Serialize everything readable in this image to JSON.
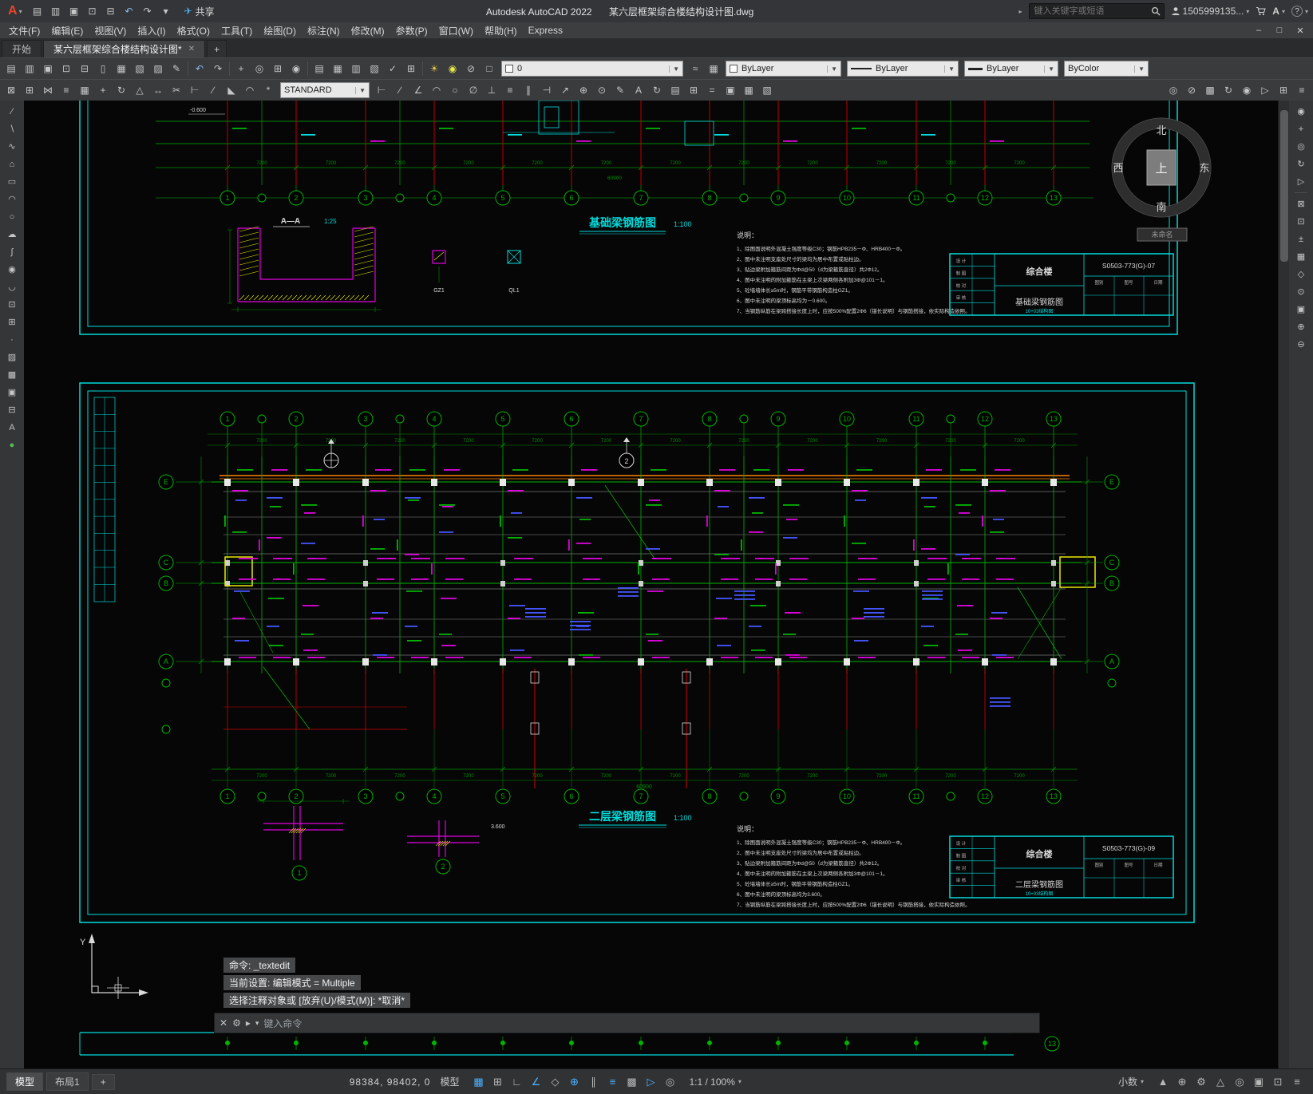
{
  "titlebar": {
    "logo": "A",
    "quick_access": [
      {
        "n": "qat-new-icon",
        "g": "▤"
      },
      {
        "n": "qat-open-icon",
        "g": "▥"
      },
      {
        "n": "qat-save-icon",
        "g": "▣"
      },
      {
        "n": "qat-save-as-icon",
        "g": "⊡"
      },
      {
        "n": "qat-plot-icon",
        "g": "⊟"
      },
      {
        "n": "qat-undo-icon",
        "g": "↶",
        "c": "#8ab8e8"
      },
      {
        "n": "qat-redo-icon",
        "g": "↷"
      },
      {
        "n": "qat-customize-icon",
        "g": "▾"
      }
    ],
    "share_label": "共享",
    "app_title": "Autodesk AutoCAD 2022",
    "doc_title": "某六层框架综合楼结构设计图.dwg",
    "search_placeholder": "键入关键字或短语",
    "user_id": "1505999135...",
    "help_label": "?"
  },
  "menubar": {
    "items": [
      "文件(F)",
      "编辑(E)",
      "视图(V)",
      "插入(I)",
      "格式(O)",
      "工具(T)",
      "绘图(D)",
      "标注(N)",
      "修改(M)",
      "参数(P)",
      "窗口(W)",
      "帮助(H)",
      "Express"
    ],
    "minimize": "–",
    "restore": "□",
    "close": "✕"
  },
  "tabs": {
    "start": "开始",
    "doc": "某六层框架综合楼结构设计图*",
    "close": "✕",
    "new_tab": "+"
  },
  "toolbar1": {
    "icons_a": [
      {
        "n": "new-icon",
        "g": "▤"
      },
      {
        "n": "open-icon",
        "g": "▥"
      },
      {
        "n": "save-icon",
        "g": "▣"
      },
      {
        "n": "save-as-icon",
        "g": "⊡"
      },
      {
        "n": "plot-icon",
        "g": "⊟"
      },
      {
        "n": "plot-preview-icon",
        "g": "▯"
      },
      {
        "n": "publish-icon",
        "g": "▦"
      },
      {
        "n": "copy-clip-icon",
        "g": "▧"
      },
      {
        "n": "paste-icon",
        "g": "▨"
      },
      {
        "n": "match-properties-icon",
        "g": "✎"
      },
      {
        "sep": true
      },
      {
        "n": "undo-icon",
        "g": "↶",
        "c": "#8ab8e8"
      },
      {
        "n": "redo-icon",
        "g": "↷"
      },
      {
        "sep": true
      },
      {
        "n": "pan-icon",
        "g": "+"
      },
      {
        "n": "zoom-realtime-icon",
        "g": "◎"
      },
      {
        "n": "zoom-window-icon",
        "g": "⊞"
      },
      {
        "n": "zoom-previous-icon",
        "g": "◉"
      },
      {
        "sep": true
      },
      {
        "n": "properties-icon",
        "g": "▤"
      },
      {
        "n": "designcenter-icon",
        "g": "▦"
      },
      {
        "n": "tool-palettes-icon",
        "g": "▥"
      },
      {
        "n": "sheet-set-manager-icon",
        "g": "▧"
      },
      {
        "n": "markup-icon",
        "g": "✓"
      },
      {
        "n": "quickcalc-icon",
        "g": "⊞"
      },
      {
        "sep": true
      },
      {
        "n": "sun-icon",
        "g": "☀",
        "c": "#e8c84a"
      },
      {
        "n": "lamp-icon",
        "g": "◉",
        "c": "#e8e84a"
      },
      {
        "n": "lock-icon",
        "g": "⊘"
      },
      {
        "n": "layer-color-icon",
        "g": "□"
      }
    ],
    "layer_value": "0",
    "icons_b": [
      {
        "n": "layer-previous-icon",
        "g": "≈"
      },
      {
        "n": "layer-states-icon",
        "g": "▦"
      }
    ],
    "color_value": "ByLayer",
    "linetype_value": "ByLayer",
    "lineweight_value": "ByLayer",
    "plotstyle_value": "ByColor"
  },
  "toolbar2": {
    "icons_a": [
      {
        "n": "erase-icon",
        "g": "⊠"
      },
      {
        "n": "copy-icon",
        "g": "⊞"
      },
      {
        "n": "mirror-icon",
        "g": "⋈"
      },
      {
        "n": "offset-icon",
        "g": "≡"
      },
      {
        "n": "array-icon",
        "g": "▦"
      },
      {
        "n": "move-icon",
        "g": "+"
      },
      {
        "n": "rotate-icon",
        "g": "↻"
      },
      {
        "n": "scale-icon",
        "g": "△"
      },
      {
        "n": "stretch-icon",
        "g": "↔"
      },
      {
        "n": "trim-icon",
        "g": "✂"
      },
      {
        "n": "extend-icon",
        "g": "⊢"
      },
      {
        "n": "break-icon",
        "g": "∕"
      },
      {
        "n": "chamfer-icon",
        "g": "◣"
      },
      {
        "n": "fillet-icon",
        "g": "◠"
      },
      {
        "n": "explode-icon",
        "g": "*"
      }
    ],
    "text_style": "STANDARD",
    "icons_b": [
      {
        "n": "dim-linear-icon",
        "g": "⊢"
      },
      {
        "n": "dim-aligned-icon",
        "g": "∕"
      },
      {
        "n": "dim-angular-icon",
        "g": "∠"
      },
      {
        "n": "dim-arc-icon",
        "g": "◠"
      },
      {
        "n": "dim-radius-icon",
        "g": "○"
      },
      {
        "n": "dim-diameter-icon",
        "g": "∅"
      },
      {
        "n": "dim-ordinate-icon",
        "g": "⊥"
      },
      {
        "n": "quick-dim-icon",
        "g": "≡"
      },
      {
        "n": "dim-baseline-icon",
        "g": "∥"
      },
      {
        "n": "dim-continue-icon",
        "g": "⊣"
      },
      {
        "n": "leader-icon",
        "g": "↗"
      },
      {
        "n": "tolerance-icon",
        "g": "⊕"
      },
      {
        "n": "center-mark-icon",
        "g": "⊙"
      },
      {
        "n": "dim-edit-icon",
        "g": "✎"
      },
      {
        "n": "dim-text-edit-icon",
        "g": "A"
      },
      {
        "n": "dim-update-icon",
        "g": "↻"
      },
      {
        "n": "dim-style-icon",
        "g": "▤"
      },
      {
        "n": "table-icon",
        "g": "⊞"
      },
      {
        "n": "field-icon",
        "g": "="
      },
      {
        "n": "block-editor-icon",
        "g": "▣"
      },
      {
        "n": "group-icon",
        "g": "▦"
      },
      {
        "n": "ungroup-icon",
        "g": "▧"
      }
    ],
    "icons_c": [
      {
        "n": "isolate-icon",
        "g": "◎"
      },
      {
        "n": "hide-objects-icon",
        "g": "⊘"
      },
      {
        "n": "render-icon",
        "g": "▩"
      },
      {
        "n": "orbit-icon",
        "g": "↻"
      },
      {
        "n": "steering-wheel-icon",
        "g": "◉"
      },
      {
        "n": "showmotion-icon",
        "g": "▷"
      },
      {
        "n": "viewcube-icon",
        "g": "⊞"
      },
      {
        "n": "navbar-icon",
        "g": "≡"
      }
    ]
  },
  "left_toolbar": {
    "icons": [
      {
        "n": "line-icon",
        "g": "∕"
      },
      {
        "n": "construction-line-icon",
        "g": "∖"
      },
      {
        "n": "polyline-icon",
        "g": "∿"
      },
      {
        "n": "polygon-icon",
        "g": "⌂"
      },
      {
        "n": "rectangle-icon",
        "g": "▭"
      },
      {
        "n": "arc-icon",
        "g": "◠"
      },
      {
        "n": "circle-icon",
        "g": "○"
      },
      {
        "n": "revision-cloud-icon",
        "g": "☁"
      },
      {
        "n": "spline-icon",
        "g": "∫"
      },
      {
        "n": "ellipse-icon",
        "g": "◉"
      },
      {
        "n": "ellipse-arc-icon",
        "g": "◡"
      },
      {
        "n": "insert-block-icon",
        "g": "⊡"
      },
      {
        "n": "create-block-icon",
        "g": "⊞"
      },
      {
        "n": "point-icon",
        "g": "·"
      },
      {
        "n": "hatch-icon",
        "g": "▨"
      },
      {
        "n": "gradient-icon",
        "g": "▩"
      },
      {
        "n": "region-icon",
        "g": "▣"
      },
      {
        "n": "table-icon",
        "g": "⊟"
      },
      {
        "n": "mtext-icon",
        "g": "A"
      },
      {
        "n": "point-style-icon",
        "g": "●",
        "c": "#55bb55"
      }
    ]
  },
  "right_toolbar": {
    "icons": [
      {
        "n": "full-nav-wheel-icon",
        "g": "◉"
      },
      {
        "n": "pan-icon",
        "g": "+"
      },
      {
        "n": "zoom-icon",
        "g": "◎"
      },
      {
        "n": "orbit-icon",
        "g": "↻"
      },
      {
        "n": "showmotion-icon",
        "g": "▷"
      },
      {
        "sep": true
      },
      {
        "n": "zoom-extents-icon",
        "g": "⊠"
      },
      {
        "n": "zoom-window-icon",
        "g": "⊡"
      },
      {
        "n": "zoom-realtime-icon",
        "g": "±"
      },
      {
        "n": "zoom-all-icon",
        "g": "▦"
      },
      {
        "n": "zoom-dynamic-icon",
        "g": "◇"
      },
      {
        "n": "zoom-center-icon",
        "g": "⊙"
      },
      {
        "n": "zoom-object-icon",
        "g": "▣"
      },
      {
        "n": "zoom-in-icon",
        "g": "⊕"
      },
      {
        "n": "zoom-out-icon",
        "g": "⊖"
      }
    ]
  },
  "drawing": {
    "compass": {
      "north": "北",
      "west": "西",
      "center": "上",
      "east": "东",
      "south": "南",
      "badge": "未命名"
    },
    "axis_numbers": [
      "1",
      "2",
      "3",
      "4",
      "5",
      "6",
      "7",
      "8",
      "9",
      "10",
      "11",
      "12",
      "13"
    ],
    "axis_letters": [
      "E",
      "C",
      "B",
      "A"
    ],
    "sheet1": {
      "title": "基础梁钢筋图",
      "scale": "1:100",
      "section_label": "A—A",
      "section_scale": "1:25",
      "elevation": "-0.600",
      "col_label": "GZ1",
      "beam_label": "QL1",
      "span_dim": "7200",
      "total_dim": "60900",
      "notes_title": "说明：",
      "notes": [
        "1、除图面说明外混凝土强度等级C30；钢筋HPB235－Φ、HRB400－Φ。",
        "2、图中未注明支座处尺寸的梁均为居中布置或贴柱边。",
        "3、贴边梁附加箍筋间距为Φd@50（d为梁箍筋直径）共2Φ12。",
        "4、图中未注明的附加箍筋在主梁上次梁两侧各附加3Φ@101－1。",
        "5、砼墙墙体长≥5m时，钢筋平带钢筋构造柱GZ1。",
        "6、图中未注明的梁顶标高均为－0.600。",
        "7、当钢筋纵筋在梁跨搭接长度上时，应按500%配置2Φ6（锚长说明）与钢筋搭接，依实际构造依照。"
      ],
      "titleblock": {
        "project": "综合楼",
        "no": "S0503-773(G)-07",
        "name": "基础梁钢筋图",
        "folio": "10+03结构图",
        "roles": [
          "设 计",
          "制 图",
          "校 对",
          "审 核"
        ],
        "cols": [
          "图别",
          "图号",
          "日期"
        ]
      }
    },
    "sheet2": {
      "title": "二层梁钢筋图",
      "scale": "1:100",
      "span_dim": "7200",
      "total_dim": "60900",
      "detail_markers": [
        "1",
        "2"
      ],
      "detail_elevation": "3.600",
      "notes_title": "说明：",
      "notes": [
        "1、除图面说明外混凝土强度等级C30；钢筋HPB235－Φ、HRB400－Φ。",
        "2、图中未注明支座处尺寸的梁均为居中布置或贴柱边。",
        "3、贴边梁附加箍筋间距为Φd@50（d为梁箍筋直径）共2Φ12。",
        "4、图中未注明的附加箍筋在主梁上次梁两侧各附加3Φ@101－1。",
        "5、砼墙墙体长≥5m时，钢筋平带钢筋构造柱GZ1。",
        "6、图中未注明的梁顶标高均为3.600。",
        "7、当钢筋纵筋在梁跨搭接长度上时，应按500%配置2Φ6（锚长说明）与钢筋搭接，依实际构造依照。"
      ],
      "titleblock": {
        "project": "综合楼",
        "no": "S0503-773(G)-09",
        "name": "二层梁钢筋图",
        "folio": "10+03结构图",
        "roles": [
          "设 计",
          "制 图",
          "校 对",
          "审 核"
        ],
        "cols": [
          "图别",
          "图号",
          "日期"
        ]
      }
    }
  },
  "command": {
    "history": [
      "命令: _textedit",
      "当前设置: 编辑模式 = Multiple",
      "选择注释对象或 [放弃(U)/模式(M)]: *取消*"
    ],
    "placeholder": "键入命令"
  },
  "statusbar": {
    "model_tab": "模型",
    "layout_tab": "布局1",
    "new_layout": "+",
    "coords": "98384, 98402, 0",
    "model_label": "模型",
    "icons": [
      {
        "n": "grid-icon",
        "g": "▦",
        "active": true
      },
      {
        "n": "snap-icon",
        "g": "⊞"
      },
      {
        "n": "ortho-icon",
        "g": "∟"
      },
      {
        "n": "polar-tracking-icon",
        "g": "∠",
        "active": true
      },
      {
        "n": "isodraft-icon",
        "g": "◇"
      },
      {
        "n": "osnap-icon",
        "g": "⊕",
        "active": true
      },
      {
        "n": "otrack-icon",
        "g": "∥"
      },
      {
        "n": "lineweight-display-icon",
        "g": "≡",
        "active": true
      },
      {
        "n": "transparency-icon",
        "g": "▩"
      },
      {
        "n": "dynamic-input-icon",
        "g": "▷",
        "active": true
      },
      {
        "n": "selection-cycling-icon",
        "g": "◎"
      }
    ],
    "scale": "1:1 / 100%",
    "units": "小数",
    "right_icons": [
      {
        "n": "annotation-visibility-icon",
        "g": "▲"
      },
      {
        "n": "autoscale-icon",
        "g": "⊕"
      },
      {
        "n": "workspace-gear-icon",
        "g": "⚙"
      },
      {
        "n": "annotation-monitor-icon",
        "g": "△"
      },
      {
        "n": "isolate-objects-icon",
        "g": "◎"
      },
      {
        "n": "graphics-performance-icon",
        "g": "▣"
      },
      {
        "n": "clean-screen-icon",
        "g": "⊡"
      },
      {
        "n": "customize-icon",
        "g": "≡"
      }
    ]
  }
}
